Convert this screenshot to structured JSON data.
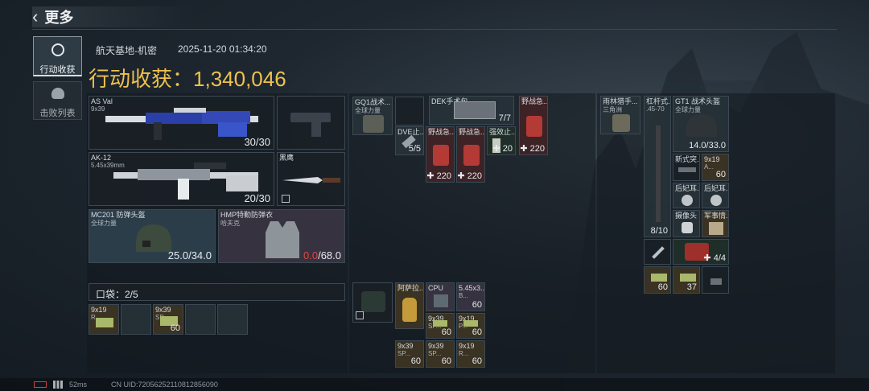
{
  "header": {
    "back_label": "更多"
  },
  "side_tabs": [
    {
      "label": "行动收获",
      "active": true
    },
    {
      "label": "击败列表",
      "active": false
    }
  ],
  "info": {
    "map": "航天基地-机密",
    "datetime": "2025-11-20 01:34:20",
    "harvest_label": "行动收获：",
    "harvest_value": "1,340,046"
  },
  "loadout": {
    "primary1": {
      "name": "AS Val",
      "sub": "9x39",
      "ammo": "30/30"
    },
    "primary2": {
      "name": "AK-12",
      "sub": "5.45x39mm",
      "ammo": "20/30"
    },
    "melee": {
      "name": "黑鹰"
    },
    "helmet": {
      "name": "MC201 防弹头盔",
      "sub": "全球力量",
      "durability": "25.0/34.0"
    },
    "armor": {
      "name": "HMP特勤防弹衣",
      "sub": "哈夫克",
      "durability_current": "0.0",
      "durability_max": "/68.0"
    },
    "pocket_label": "口袋：2/5",
    "pocket_items": [
      {
        "name": "9x19",
        "sub": "R...",
        "count": ""
      },
      {
        "name": "9x39",
        "sub": "SP...",
        "count": "60"
      }
    ]
  },
  "chest_rig": {
    "items": [
      {
        "name": "GQ1战术...",
        "sub": "全球力量"
      },
      {
        "name": "DEK手术包",
        "count": "7/7"
      },
      {
        "name": "野战急...",
        "count": "220"
      },
      {
        "name": "DVE止...",
        "count": "5/5"
      },
      {
        "name": "野战急...",
        "count": "220"
      },
      {
        "name": "野战急...",
        "count": "220"
      },
      {
        "name": "强效止...",
        "count": "20"
      }
    ]
  },
  "backpack": {
    "items": [
      {
        "name": "阿萨拉..."
      },
      {
        "name": "CPU"
      },
      {
        "name": "5.45x3...",
        "sub": "B...",
        "count": "60"
      },
      {
        "name": "9x39",
        "sub": "SP...",
        "count": "60"
      },
      {
        "name": "9x19",
        "sub": "P...",
        "count": "60"
      },
      {
        "name": "9x39",
        "sub": "SP...",
        "count": "60"
      },
      {
        "name": "9x39",
        "sub": "SP...",
        "count": "60"
      },
      {
        "name": "9x19",
        "sub": "R...",
        "count": "60"
      }
    ]
  },
  "safe_box": {
    "items": [
      {
        "name": "雨林猎手...",
        "sub": "三角洲"
      },
      {
        "name": "杠杆式...",
        "sub": ".45-70",
        "count": "8/10"
      },
      {
        "name": "GT1 战术头盔",
        "sub": "全球力量",
        "count": "14.0/33.0"
      },
      {
        "name": "新式突..."
      },
      {
        "name": "9x19",
        "sub": "A...",
        "count": "60"
      },
      {
        "name": "后妃耳..."
      },
      {
        "name": "后妃耳..."
      },
      {
        "name": "摄像头"
      },
      {
        "name": "军事情..."
      },
      {
        "name": "",
        "count": "4/4"
      },
      {
        "name": "",
        "count": "60"
      },
      {
        "name": "",
        "count": "37"
      }
    ]
  },
  "footer": {
    "ping": "52ms",
    "uid": "CN UID:72056252110812856090"
  }
}
